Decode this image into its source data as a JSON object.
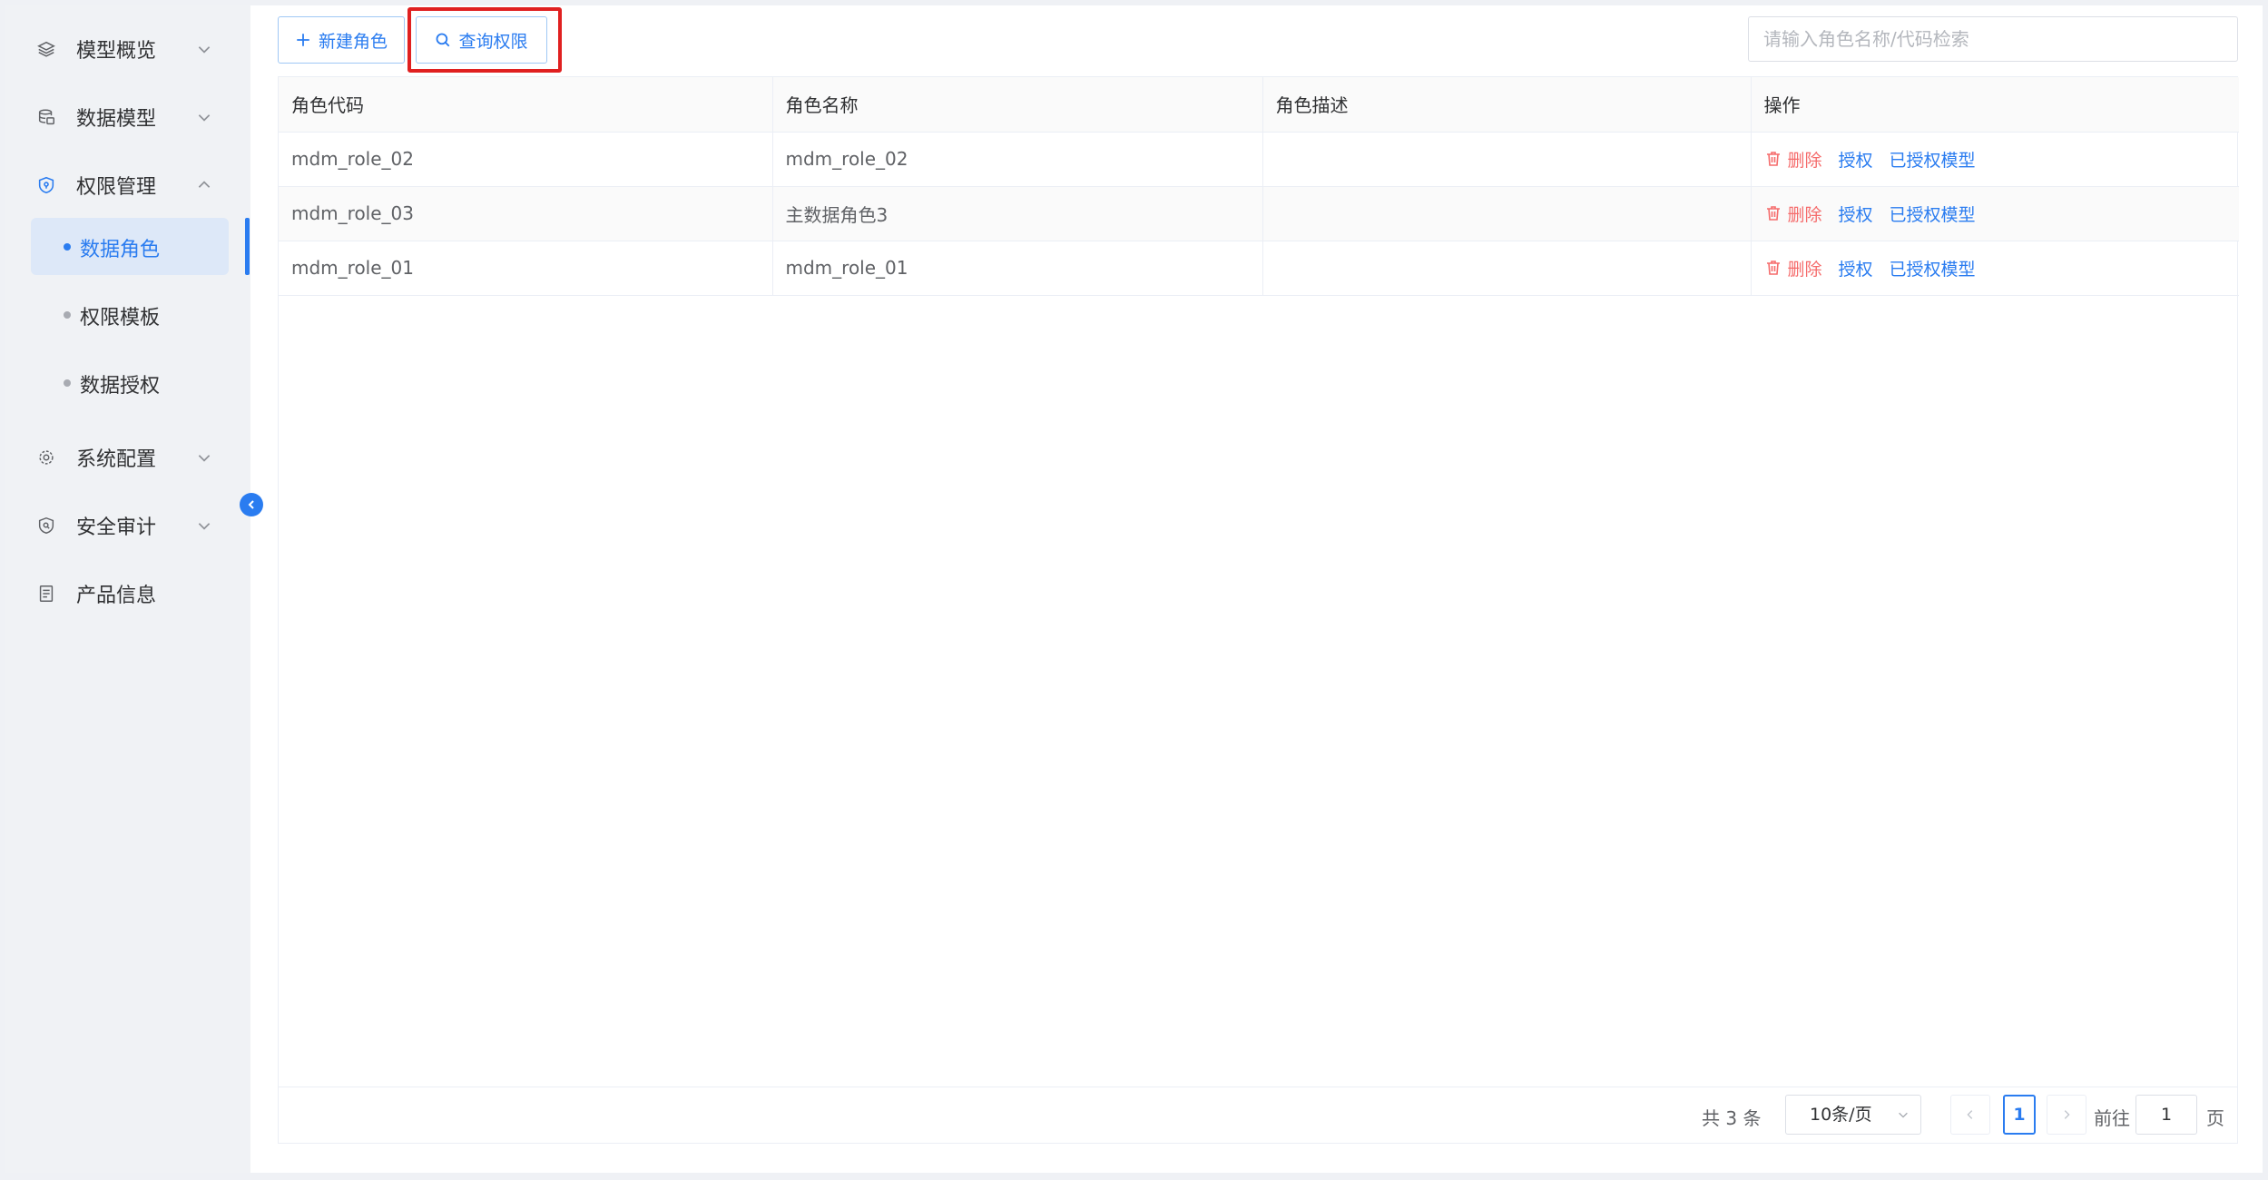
{
  "sidebar": {
    "items": [
      {
        "label": "模型概览",
        "icon": "layers-icon"
      },
      {
        "label": "数据模型",
        "icon": "database-icon"
      },
      {
        "label": "权限管理",
        "icon": "shield-icon"
      },
      {
        "label": "系统配置",
        "icon": "gear-icon"
      },
      {
        "label": "安全审计",
        "icon": "audit-icon"
      },
      {
        "label": "产品信息",
        "icon": "document-icon"
      }
    ],
    "subitems": [
      {
        "label": "数据角色",
        "active": true
      },
      {
        "label": "权限模板"
      },
      {
        "label": "数据授权"
      }
    ]
  },
  "toolbar": {
    "new_label": "新建角色",
    "query_label": "查询权限",
    "search_placeholder": "请输入角色名称/代码检索"
  },
  "table": {
    "headers": [
      "角色代码",
      "角色名称",
      "角色描述",
      "操作"
    ],
    "rows": [
      {
        "code": "mdm_role_02",
        "name": "mdm_role_02",
        "desc": ""
      },
      {
        "code": "mdm_role_03",
        "name": "主数据角色3",
        "desc": ""
      },
      {
        "code": "mdm_role_01",
        "name": "mdm_role_01",
        "desc": ""
      }
    ],
    "ops": {
      "delete": "删除",
      "grant": "授权",
      "granted": "已授权模型"
    }
  },
  "pagination": {
    "total": "共 3 条",
    "page_size": "10条/页",
    "current_page": "1",
    "goto_label": "前往",
    "goto_value": "1",
    "unit": "页"
  },
  "colors": {
    "accent": "#2a7cf0",
    "danger": "#f56c6c",
    "highlight": "#e02020"
  }
}
